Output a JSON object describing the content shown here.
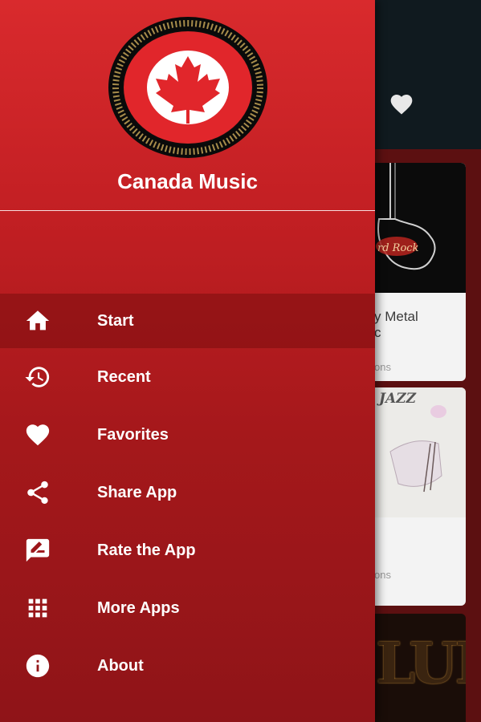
{
  "drawer": {
    "app_name": "Canada Music",
    "logo_icon": "maple-leaf-icon",
    "menu": [
      {
        "label": "Start",
        "icon": "home-icon"
      },
      {
        "label": "Recent",
        "icon": "history-icon"
      },
      {
        "label": "Favorites",
        "icon": "heart-icon"
      },
      {
        "label": "Share App",
        "icon": "share-icon"
      },
      {
        "label": "Rate the App",
        "icon": "rate-review-icon"
      },
      {
        "label": "More Apps",
        "icon": "apps-grid-icon"
      },
      {
        "label": "About",
        "icon": "info-icon"
      }
    ]
  },
  "background": {
    "appbar_icon": "heart-icon",
    "cards": [
      {
        "title": "y Metal",
        "title2": "c",
        "subtitle": "ons"
      },
      {
        "art_text": "JAZZ",
        "subtitle": "ons"
      },
      {
        "art_text": "LUES"
      }
    ]
  },
  "colors": {
    "drawer_top": "#d92a2d",
    "drawer_bottom": "#8f1418",
    "appbar": "#101a1f",
    "canada_red": "#e1262b"
  }
}
